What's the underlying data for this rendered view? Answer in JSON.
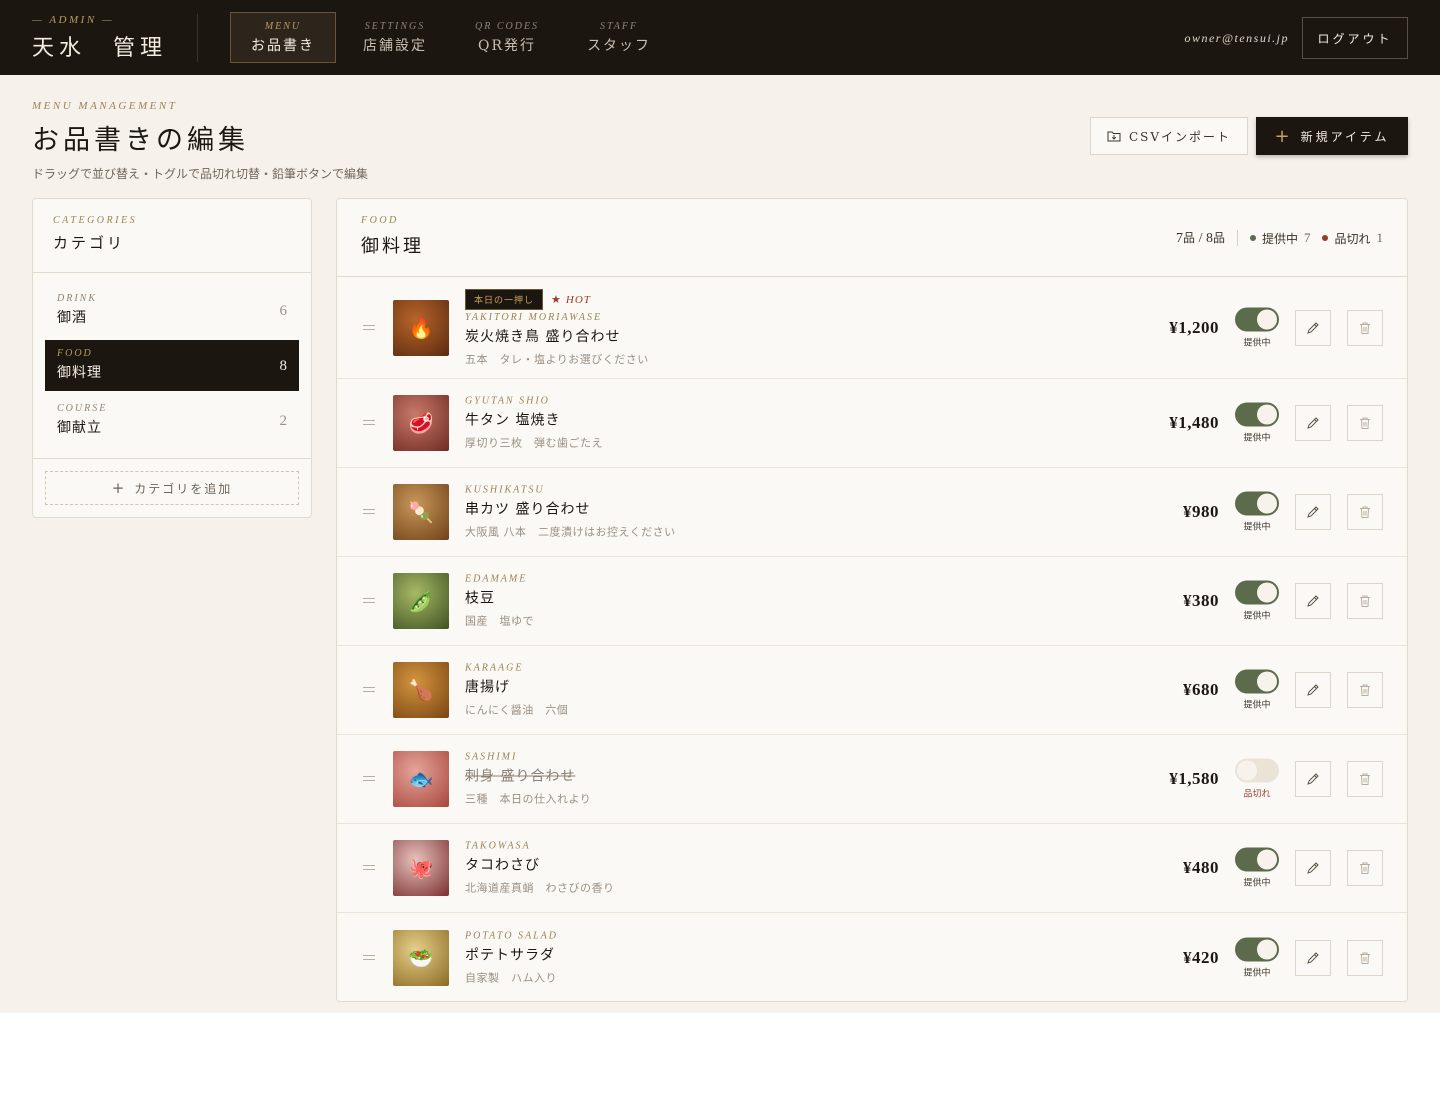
{
  "header": {
    "brand_sub": "— ADMIN —",
    "brand_title": "天水　管理",
    "nav": [
      {
        "sub": "MENU",
        "label": "お品書き",
        "active": true
      },
      {
        "sub": "SETTINGS",
        "label": "店舗設定",
        "active": false
      },
      {
        "sub": "QR CODES",
        "label": "QR発行",
        "active": false
      },
      {
        "sub": "STAFF",
        "label": "スタッフ",
        "active": false
      }
    ],
    "owner_email": "owner@tensui.jp",
    "logout_label": "ログアウト"
  },
  "page": {
    "eyebrow": "MENU MANAGEMENT",
    "title": "お品書きの編集",
    "description": "ドラッグで並び替え・トグルで品切れ切替・鉛筆ボタンで編集",
    "csv_label": "CSVインポート",
    "new_label": "新規アイテム"
  },
  "categories": {
    "eyebrow": "CATEGORIES",
    "title": "カテゴリ",
    "items": [
      {
        "sub": "DRINK",
        "name": "御酒",
        "count": "6",
        "active": false
      },
      {
        "sub": "FOOD",
        "name": "御料理",
        "count": "8",
        "active": true
      },
      {
        "sub": "COURSE",
        "name": "御献立",
        "count": "2",
        "active": false
      }
    ],
    "add_label": "カテゴリを追加"
  },
  "items_panel": {
    "eyebrow": "FOOD",
    "title": "御料理",
    "count_available": "7",
    "count_total": "8",
    "count_unit": "品",
    "available_label": "提供中",
    "available_num": "7",
    "soldout_label": "品切れ",
    "soldout_num": "1"
  },
  "items": [
    {
      "sub": "YAKITORI MORIAWASE",
      "name": "炭火焼き鳥 盛り合わせ",
      "desc": "五本　タレ・塩よりお選びください",
      "price": "¥1,200",
      "available": true,
      "status": "提供中",
      "badge_rec": "本日の一押し",
      "badge_hot": "HOT",
      "emoji": "🔥",
      "thumb_colors": [
        "#b8652a",
        "#5a2a10"
      ]
    },
    {
      "sub": "GYUTAN SHIO",
      "name": "牛タン 塩焼き",
      "desc": "厚切り三枚　弾む歯ごたえ",
      "price": "¥1,480",
      "available": true,
      "status": "提供中",
      "emoji": "🥩",
      "thumb_colors": [
        "#c87a6a",
        "#6e2a22"
      ]
    },
    {
      "sub": "KUSHIKATSU",
      "name": "串カツ 盛り合わせ",
      "desc": "大阪風 八本　二度漬けはお控えください",
      "price": "¥980",
      "available": true,
      "status": "提供中",
      "emoji": "🍡",
      "thumb_colors": [
        "#c9975a",
        "#6e4218"
      ]
    },
    {
      "sub": "EDAMAME",
      "name": "枝豆",
      "desc": "国産　塩ゆで",
      "price": "¥380",
      "available": true,
      "status": "提供中",
      "emoji": "🫛",
      "thumb_colors": [
        "#a8b867",
        "#3e5220"
      ]
    },
    {
      "sub": "KARAAGE",
      "name": "唐揚げ",
      "desc": "にんにく醤油　六個",
      "price": "¥680",
      "available": true,
      "status": "提供中",
      "emoji": "🍗",
      "thumb_colors": [
        "#d2953e",
        "#7a4412"
      ]
    },
    {
      "sub": "SASHIMI",
      "name": "刺身 盛り合わせ",
      "desc": "三種　本日の仕入れより",
      "price": "¥1,580",
      "available": false,
      "status": "品切れ",
      "emoji": "🐟",
      "thumb_colors": [
        "#e6a49a",
        "#a8463c"
      ]
    },
    {
      "sub": "TAKOWASA",
      "name": "タコわさび",
      "desc": "北海道産真蛸　わさびの香り",
      "price": "¥480",
      "available": true,
      "status": "提供中",
      "emoji": "🐙",
      "thumb_colors": [
        "#e6c2bc",
        "#7a2e2e"
      ]
    },
    {
      "sub": "POTATO SALAD",
      "name": "ポテトサラダ",
      "desc": "自家製　ハム入り",
      "price": "¥420",
      "available": true,
      "status": "提供中",
      "emoji": "🥗",
      "thumb_colors": [
        "#e6cf8a",
        "#8a6a22"
      ]
    }
  ],
  "colors": {
    "header_bg": "#1c1611",
    "accent_gold": "#b79a62",
    "available_green": "#5c6b4c",
    "soldout_red": "#9b3a2c",
    "page_bg": "#f6f2eb"
  },
  "icons": {
    "csv": "folder-import-icon",
    "new": "plus-icon",
    "drag": "drag-handle-icon",
    "edit": "pencil-icon",
    "delete": "trash-icon"
  }
}
